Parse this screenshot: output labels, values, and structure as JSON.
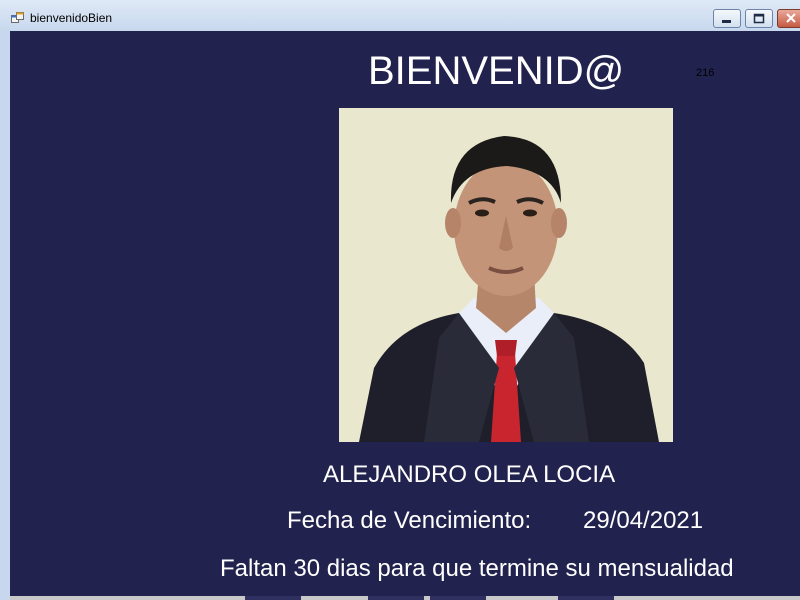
{
  "window": {
    "title": "bienvenidoBien",
    "controls": {
      "minimize_icon": "minimize-icon",
      "maximize_icon": "maximize-icon",
      "close_icon": "close-icon"
    }
  },
  "main": {
    "heading": "BIENVENID@",
    "counter": "216",
    "member_name": "ALEJANDRO OLEA LOCIA",
    "expiration_label": "Fecha de Vencimiento:",
    "expiration_date": "29/04/2021",
    "remaining_message": "Faltan 30 dias para que termine su mensualidad"
  },
  "colors": {
    "background": "#22224f",
    "text": "#ffffff",
    "photo_background": "#ecebd2"
  }
}
